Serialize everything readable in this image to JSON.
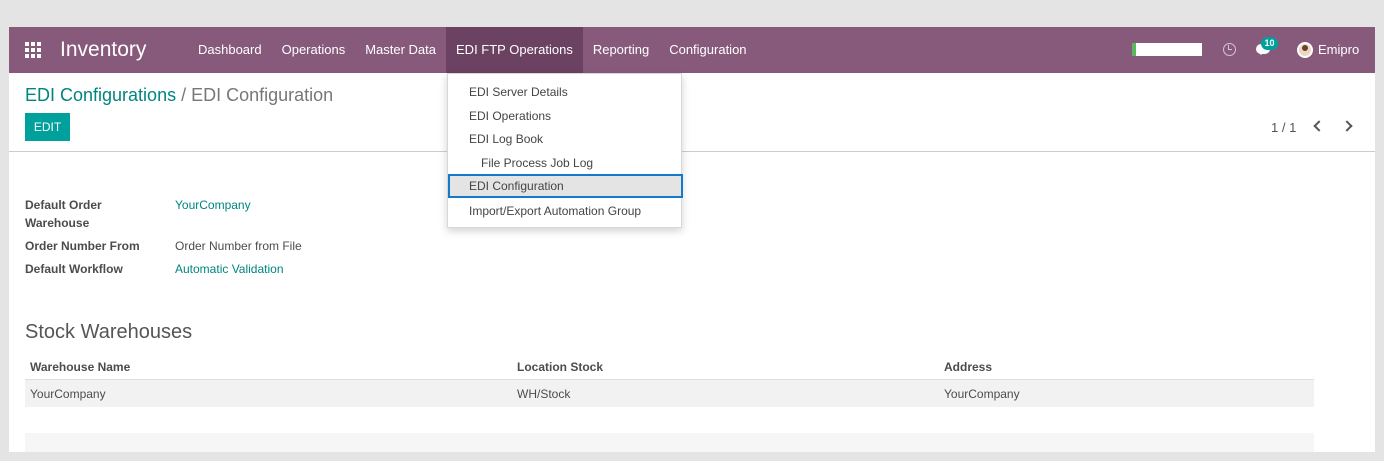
{
  "navbar": {
    "brand": "Inventory",
    "menu": [
      "Dashboard",
      "Operations",
      "Master Data",
      "EDI FTP Operations",
      "Reporting",
      "Configuration"
    ],
    "active_menu": "EDI FTP Operations",
    "messages_count": "10",
    "user_name": "Emipro",
    "icons": [
      "apps-grid-icon",
      "clock-icon",
      "chat-icon",
      "avatar"
    ]
  },
  "breadcrumb": {
    "parent": "EDI Configurations",
    "separator": "/",
    "current": "EDI Configuration"
  },
  "control_panel": {
    "edit_label": "EDIT",
    "pager": "1 / 1"
  },
  "form": {
    "fields": [
      {
        "label": "Default Order Warehouse",
        "value": "YourCompany"
      },
      {
        "label": "Order Number From",
        "value": "Order Number from File"
      },
      {
        "label": "Default Workflow",
        "value": "Automatic Validation"
      }
    ]
  },
  "warehouses": {
    "title": "Stock Warehouses",
    "columns": [
      "Warehouse Name",
      "Location Stock",
      "Address"
    ],
    "rows": [
      [
        "YourCompany",
        "WH/Stock",
        "YourCompany"
      ]
    ]
  },
  "dropdown": {
    "items": [
      {
        "label": "EDI Server Details"
      },
      {
        "label": "EDI Operations"
      },
      {
        "label": "EDI Log Book"
      },
      {
        "label": "File Process Job Log"
      },
      {
        "label": "EDI Configuration"
      },
      {
        "label": "Import/Export Automation Group"
      }
    ],
    "selected": "EDI Configuration"
  },
  "colors": {
    "navbar": "#875a7b",
    "active_menu": "#6b4261",
    "accent": "#00a09d",
    "link": "#00857f",
    "focus_border": "#1678c8"
  }
}
